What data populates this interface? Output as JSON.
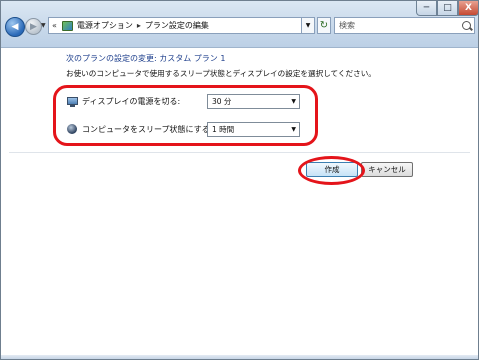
{
  "window": {
    "controls": {
      "minimize": "─",
      "maximize": "□",
      "close": "X"
    }
  },
  "nav": {
    "back_icon": "back-arrow-icon",
    "forward_icon": "forward-arrow-icon",
    "address_chevron": "«",
    "breadcrumbs": [
      "電源オプション",
      "プラン設定の編集"
    ],
    "separator": "▸",
    "search_placeholder": "検索"
  },
  "main": {
    "heading": "次のプランの設定の変更: カスタム プラン 1",
    "description": "お使いのコンピュータで使用するスリープ状態とディスプレイの設定を選択してください。",
    "settings": [
      {
        "label": "ディスプレイの電源を切る:",
        "value": "30 分",
        "icon": "monitor-icon"
      },
      {
        "label": "コンピュータをスリープ状態にする:",
        "value": "1 時間",
        "icon": "sleep-moon-icon"
      }
    ]
  },
  "buttons": {
    "create": "作成",
    "cancel": "キャンセル"
  },
  "colors": {
    "heading": "#1e3f8c",
    "highlight": "#e4141a"
  }
}
